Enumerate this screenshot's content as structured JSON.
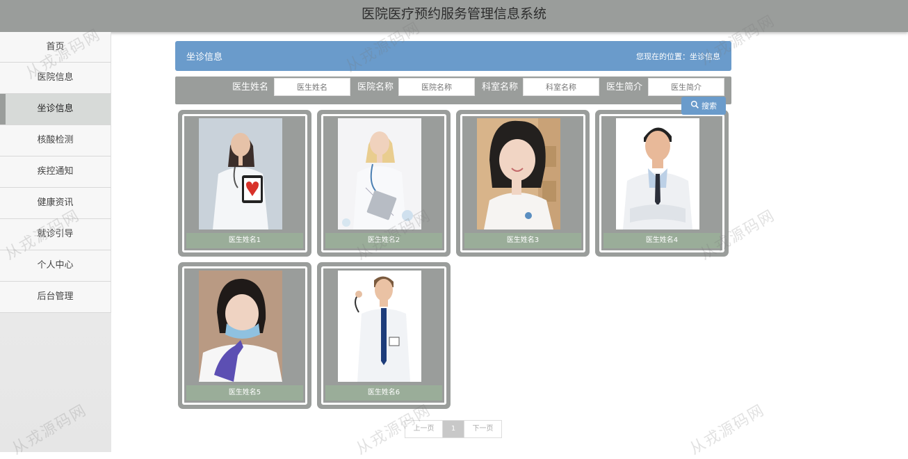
{
  "app": {
    "title": "医院医疗预约服务管理信息系统"
  },
  "sidebar": {
    "items": [
      {
        "label": "首页"
      },
      {
        "label": "医院信息"
      },
      {
        "label": "坐诊信息"
      },
      {
        "label": "核酸检测"
      },
      {
        "label": "疾控通知"
      },
      {
        "label": "健康资讯"
      },
      {
        "label": "就诊引导"
      },
      {
        "label": "个人中心"
      },
      {
        "label": "后台管理"
      }
    ],
    "active_index": 2
  },
  "header": {
    "title": "坐诊信息",
    "location": "您现在的位置：坐诊信息"
  },
  "search": {
    "fields": [
      {
        "label": "医生姓名",
        "placeholder": "医生姓名"
      },
      {
        "label": "医院名称",
        "placeholder": "医院名称"
      },
      {
        "label": "科室名称",
        "placeholder": "科室名称"
      },
      {
        "label": "医生简介",
        "placeholder": "医生简介"
      }
    ],
    "button_label": "搜索",
    "button_icon": "search-icon"
  },
  "cards": [
    {
      "name": "医生姓名1"
    },
    {
      "name": "医生姓名2"
    },
    {
      "name": "医生姓名3"
    },
    {
      "name": "医生姓名4"
    },
    {
      "name": "医生姓名5"
    },
    {
      "name": "医生姓名6"
    }
  ],
  "pagination": {
    "prev": "上一页",
    "current": "1",
    "next": "下一页"
  },
  "watermark": "从戎源码网",
  "colors": {
    "header_blue": "#6a9bcb",
    "gray": "#9a9d9b",
    "name_bar": "#9aad99"
  }
}
